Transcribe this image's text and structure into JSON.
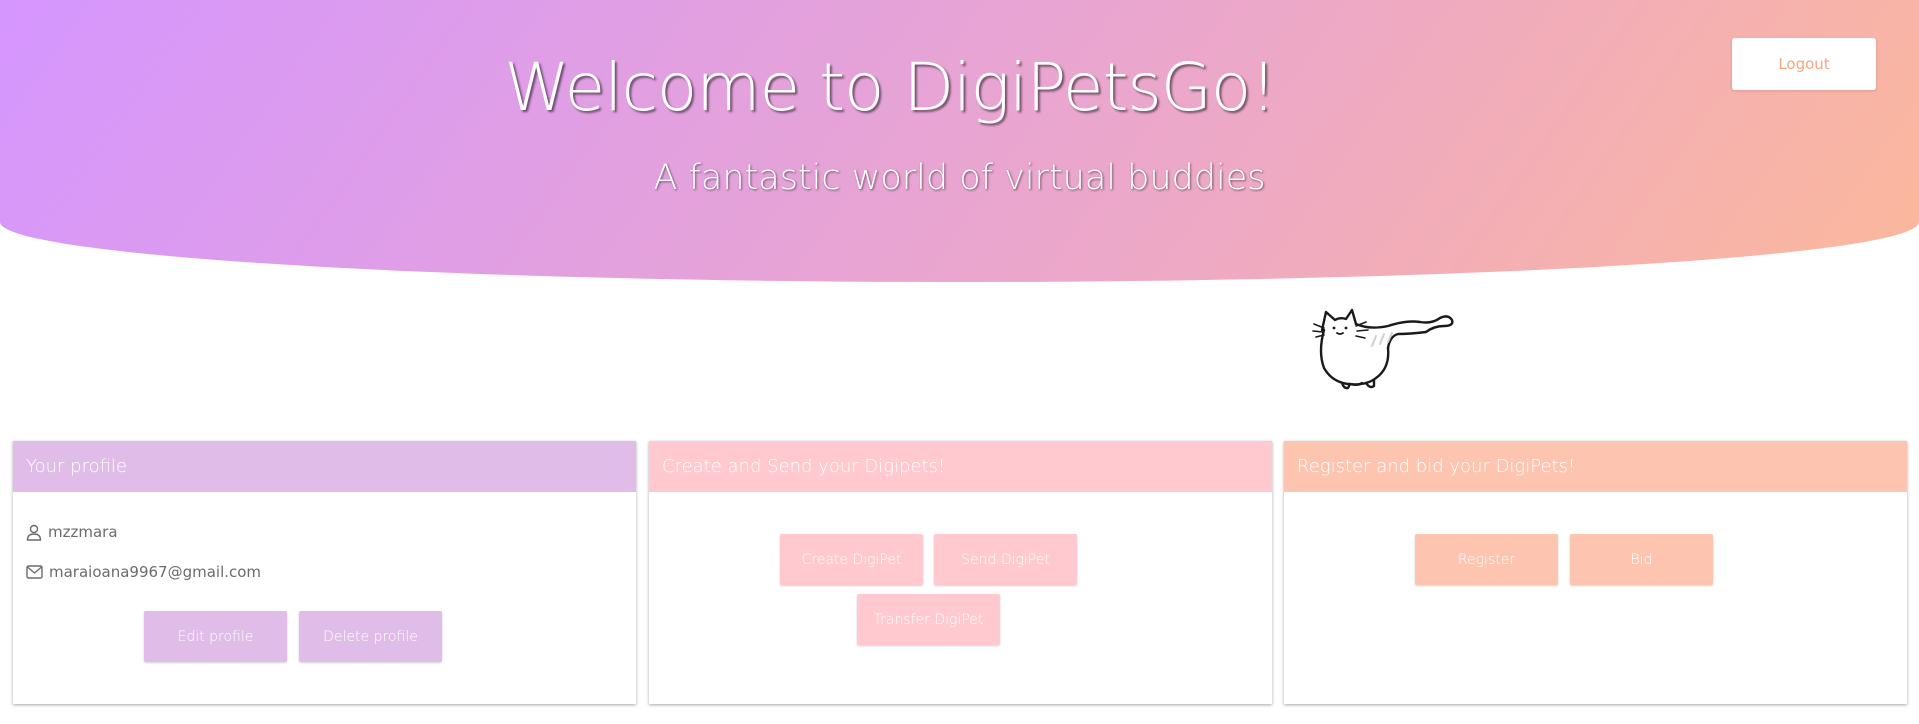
{
  "header": {
    "title": "Welcome to DigiPetsGo!",
    "subtitle": "A fantastic world of virtual buddies",
    "logout_label": "Logout"
  },
  "illustration": {
    "icon": "cat-drawing"
  },
  "colors": {
    "gradient_start": "#d596ff",
    "gradient_end": "#fcb89b",
    "profile_accent": "#e0bde8",
    "create_accent": "#ffc9cf",
    "register_accent": "#fdc5b0"
  },
  "profile_card": {
    "title": "Your profile",
    "username": "mzzmara",
    "email": "maraioana9967@gmail.com",
    "edit_label": "Edit profile",
    "delete_label": "Delete profile"
  },
  "create_card": {
    "title": "Create and Send your Digipets!",
    "create_label": "Create DigiPet",
    "send_label": "Send DigiPet",
    "transfer_label": "Transfer DigiPet"
  },
  "register_card": {
    "title": "Register and bid your DigiPets!",
    "register_label": "Register",
    "bid_label": "Bid"
  }
}
